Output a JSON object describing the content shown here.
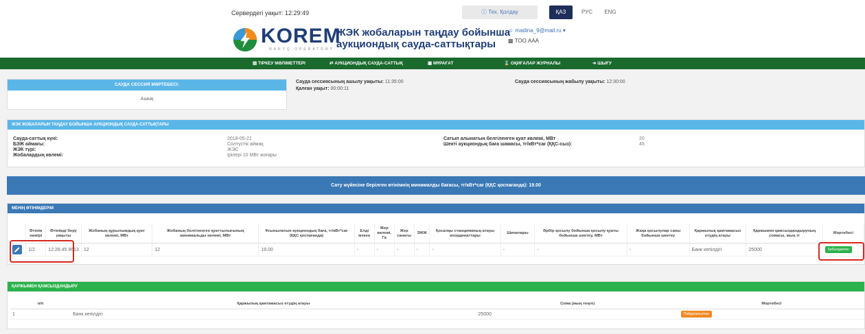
{
  "topbar": {
    "server_time": "Сервердегі уақыт: 12:29:49",
    "support": "Тех. Қолдау",
    "languages": [
      "ҚАЗ",
      "РУС",
      "ENG"
    ]
  },
  "header": {
    "logo": "KOREM",
    "logo_sub": "NARYQ OPERATORY",
    "title_line1": "ЖЭК жобаларын таңдау бойынша",
    "title_line2": "аукциондық сауда-саттықтары",
    "user_email": "madina_9@mail.ru",
    "user_org": "ТОО ААА"
  },
  "nav": {
    "items": [
      "ТІРКЕУ МӘЛІМЕТТЕРІ",
      "АУКЦИОНДЫҚ САУДА-САТТЫҚ",
      "МҰРАҒАТ",
      "ОҚИҒАЛАР ЖУРНАЛЫ",
      "ШЫҒУ"
    ]
  },
  "session": {
    "heading": "САУДА СЕССИЯ МӘРТЕБЕСІ:",
    "status": "Ашық",
    "open_label": "Сауда сессиясының ашылу уақыты:",
    "open_value": "11:35:00",
    "remaining_label": "Қалған уақыт:",
    "remaining_value": "00:00:11",
    "close_label": "Сауда сессиясының жабылу уақыты:",
    "close_value": "12:30:00"
  },
  "auction": {
    "heading": "ЖЭК ЖОБАЛАРЫН ТАҢДАУ БОЙЫНША АУКЦИОНДЫҚ САУДА-САТТЫҚТАРЫ",
    "left_labels": [
      "Сауда-саттық күні:",
      "БЭЖ аймағы:",
      "ЖЭК түрі:",
      "Жобалардың көлемі:"
    ],
    "left_values": [
      "2018-05-21",
      "Солтүстік аймақ",
      "ЖЭС",
      "Ірілері 10 МВт жоғары"
    ],
    "right_labels": [
      "Сатып алынатын белгіленген қуат көлемі, МВт",
      "Шекті аукциондық баға шамасы, тг/кВт*сағ (ҚҚС-сыз):"
    ],
    "right_values": [
      "20",
      "45"
    ]
  },
  "min_price_text": "Сату жүйесіне берілген өтінімнің минималды бағасы, тг/кВт*сағ (ҚҚС қоспағанда): 19.00",
  "bids": {
    "heading": "МЕНІҢ ӨТІНІМДЕРІМ",
    "columns": [
      "",
      "Өтінім нөмірі",
      "Өтінімді беру уақыты",
      "Жобаның құрылымдық қуат көлемі, МВт",
      "Жобаның белгіленген қуаттылығының минимальды көлемі, МВт",
      "Ұсынылатын аукциондық баға, тг/кВт*сағ (ҚҚС қоспағанда)",
      "Елді мекен",
      "Жер көлемі, Га",
      "Жер санаты",
      "ЭЖЖ",
      "Қосалқы станциямның атауы координаттары",
      "Шиналары",
      "Әрбір қосылу бойынша қосылу қуаты бойынша шектеу, МВт",
      "Жаңа қосылулар саны бойынша шектеу",
      "Қаржылық қамтамасыз етудің атауы",
      "Қаржымен қамсыздандыруның сомасы, мың тг",
      "Мәртебесі"
    ],
    "row": [
      "",
      "1/2",
      "12:26:45.9613",
      "12",
      "12",
      "19.00",
      "-",
      "-",
      "-",
      "-",
      "-",
      "-",
      "-",
      "-",
      "Банк кепілдігі",
      "25000",
      "Қабылданған"
    ]
  },
  "finance": {
    "heading": "ҚАРЖЫМЕН ҚАМСЫЗДАНДЫРУ",
    "columns": [
      "п/п",
      "Қаржылық қамтамасыз етудің атауы",
      "Сома (мың теңге)",
      "Мәртебесі"
    ],
    "row": [
      "1",
      "Банк кепілдігі",
      "25000",
      "Пайдаланылған"
    ]
  }
}
